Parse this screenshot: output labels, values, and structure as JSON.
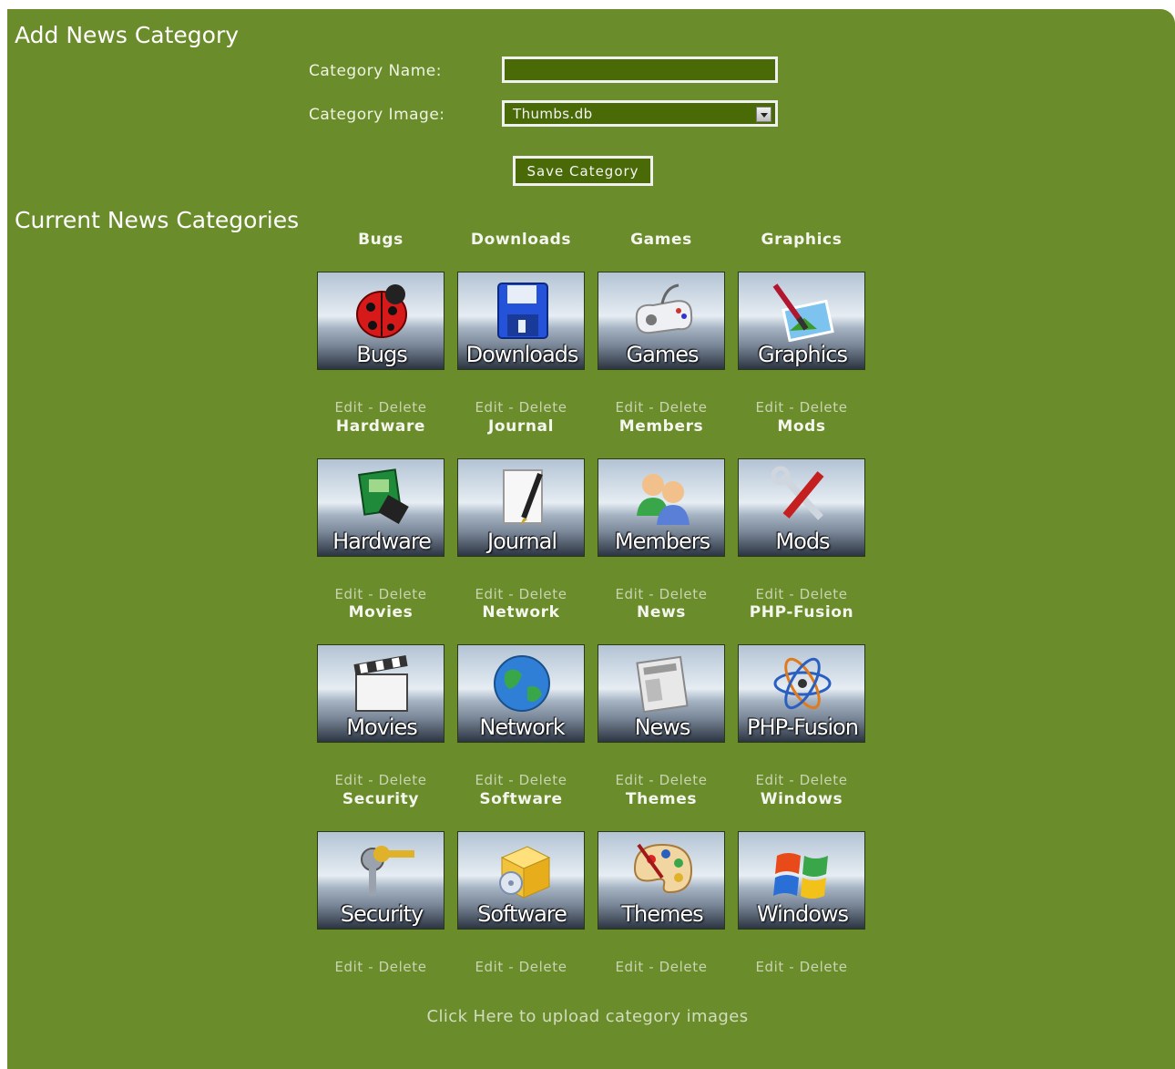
{
  "form": {
    "title": "Add News Category",
    "name_label": "Category Name:",
    "name_value": "",
    "image_label": "Category Image:",
    "image_selected": "Thumbs.db",
    "save_label": "Save Category"
  },
  "list": {
    "title": "Current News Categories",
    "edit_label": "Edit",
    "separator": "-",
    "delete_label": "Delete",
    "categories": [
      {
        "name": "Bugs",
        "image_text": "Bugs",
        "icon": "ladybug-icon"
      },
      {
        "name": "Downloads",
        "image_text": "Downloads",
        "icon": "floppy-disk-icon"
      },
      {
        "name": "Games",
        "image_text": "Games",
        "icon": "gamepad-icon"
      },
      {
        "name": "Graphics",
        "image_text": "Graphics",
        "icon": "paintbrush-picture-icon"
      },
      {
        "name": "Hardware",
        "image_text": "Hardware",
        "icon": "circuit-board-icon"
      },
      {
        "name": "Journal",
        "image_text": "Journal",
        "icon": "notepad-pen-icon"
      },
      {
        "name": "Members",
        "image_text": "Members",
        "icon": "users-icon"
      },
      {
        "name": "Mods",
        "image_text": "Mods",
        "icon": "tools-icon"
      },
      {
        "name": "Movies",
        "image_text": "Movies",
        "icon": "clapperboard-icon"
      },
      {
        "name": "Network",
        "image_text": "Network",
        "icon": "globe-icon"
      },
      {
        "name": "News",
        "image_text": "News",
        "icon": "newspaper-icon"
      },
      {
        "name": "PHP-Fusion",
        "image_text": "PHP-Fusion",
        "icon": "atom-icon"
      },
      {
        "name": "Security",
        "image_text": "Security",
        "icon": "keys-icon"
      },
      {
        "name": "Software",
        "image_text": "Software",
        "icon": "software-box-icon"
      },
      {
        "name": "Themes",
        "image_text": "Themes",
        "icon": "palette-icon"
      },
      {
        "name": "Windows",
        "image_text": "Windows",
        "icon": "windows-logo-icon"
      }
    ]
  },
  "upload_link": "Click Here to upload category images",
  "colors": {
    "panel": "#6b8c2a",
    "field_bg": "#4a6a08",
    "link": "#c9d4b3"
  }
}
